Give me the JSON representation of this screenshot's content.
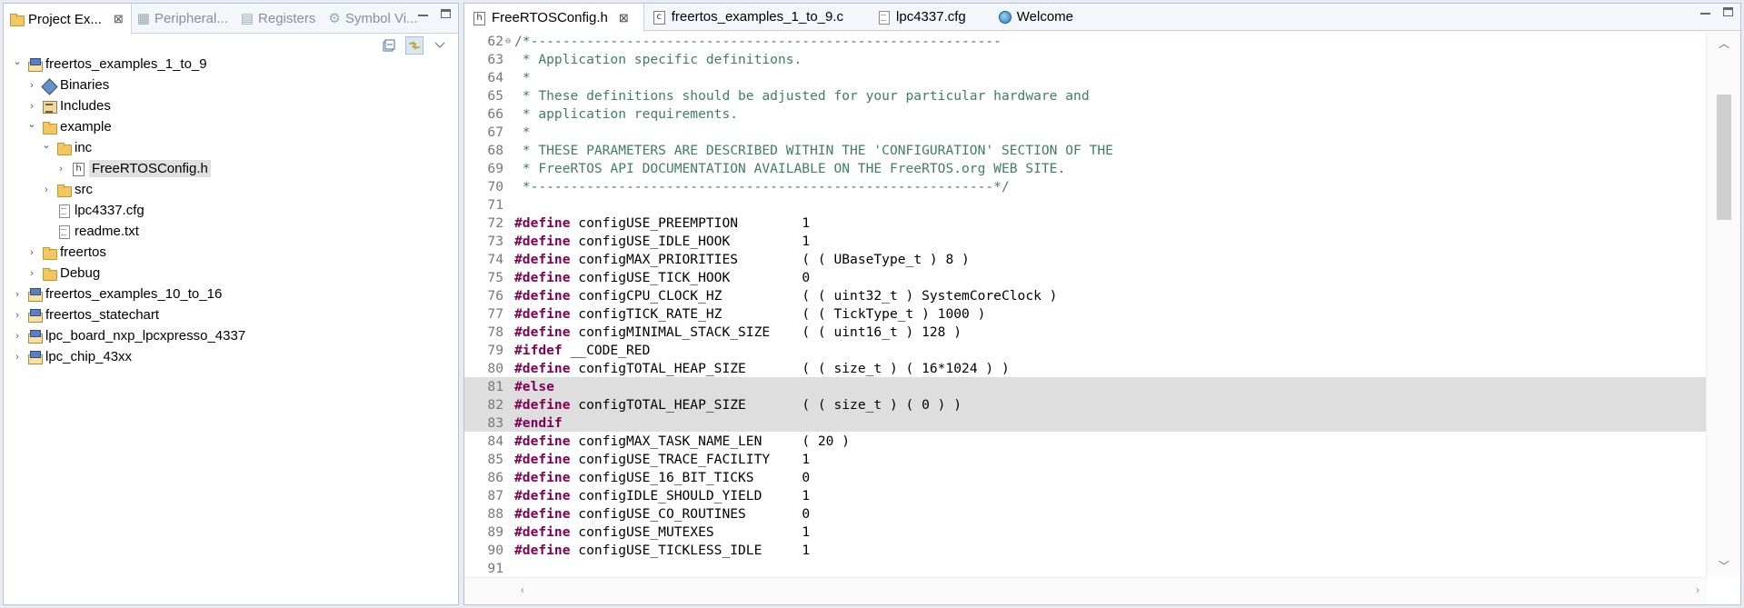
{
  "left_pane": {
    "tabs": [
      {
        "label": "Project Ex...",
        "close": "⊠",
        "active": true
      },
      {
        "label": "Peripheral...",
        "active": false
      },
      {
        "label": "Registers",
        "active": false
      },
      {
        "label": "Symbol Vi...",
        "active": false
      }
    ],
    "tree": [
      {
        "label": "freertos_examples_1_to_9",
        "expanded": true,
        "icon": "project-icon",
        "depth": 0
      },
      {
        "label": "Binaries",
        "expanded": false,
        "icon": "binaries-icon",
        "depth": 1
      },
      {
        "label": "Includes",
        "expanded": false,
        "icon": "includes-icon",
        "depth": 1
      },
      {
        "label": "example",
        "expanded": true,
        "icon": "folder-icon",
        "depth": 1
      },
      {
        "label": "inc",
        "expanded": true,
        "icon": "folder-icon",
        "depth": 2
      },
      {
        "label": "FreeRTOSConfig.h",
        "expanded": false,
        "icon": "header-file-icon",
        "depth": 3,
        "selected": true
      },
      {
        "label": "src",
        "expanded": false,
        "icon": "folder-icon",
        "depth": 2
      },
      {
        "label": "lpc4337.cfg",
        "icon": "file-icon",
        "depth": 2,
        "leaf": true
      },
      {
        "label": "readme.txt",
        "icon": "file-icon",
        "depth": 2,
        "leaf": true
      },
      {
        "label": "freertos",
        "expanded": false,
        "icon": "folder-icon",
        "depth": 1
      },
      {
        "label": "Debug",
        "expanded": false,
        "icon": "folder-icon",
        "depth": 1
      },
      {
        "label": "freertos_examples_10_to_16",
        "expanded": false,
        "icon": "project-icon",
        "depth": 0
      },
      {
        "label": "freertos_statechart",
        "expanded": false,
        "icon": "project-icon",
        "depth": 0
      },
      {
        "label": "lpc_board_nxp_lpcxpresso_4337",
        "expanded": false,
        "icon": "project-icon",
        "depth": 0
      },
      {
        "label": "lpc_chip_43xx",
        "expanded": false,
        "icon": "project-icon",
        "depth": 0
      }
    ]
  },
  "editor": {
    "tabs": [
      {
        "label": "FreeRTOSConfig.h",
        "icon": "header-file-icon",
        "active": true,
        "close": "⊠"
      },
      {
        "label": "freertos_examples_1_to_9.c",
        "icon": "c-file-icon",
        "active": false
      },
      {
        "label": "lpc4337.cfg",
        "icon": "file-icon",
        "active": false
      },
      {
        "label": "Welcome",
        "icon": "globe-icon",
        "active": false
      }
    ],
    "lines": [
      {
        "n": "62",
        "fold": "⊖",
        "parts": [
          [
            "c",
            "/*-----------------------------------------------------------"
          ]
        ]
      },
      {
        "n": "63",
        "parts": [
          [
            "c",
            " * Application specific definitions."
          ]
        ]
      },
      {
        "n": "64",
        "parts": [
          [
            "c",
            " *"
          ]
        ]
      },
      {
        "n": "65",
        "parts": [
          [
            "c",
            " * These definitions should be adjusted for your particular hardware and"
          ]
        ]
      },
      {
        "n": "66",
        "parts": [
          [
            "c",
            " * application requirements."
          ]
        ]
      },
      {
        "n": "67",
        "parts": [
          [
            "c",
            " *"
          ]
        ]
      },
      {
        "n": "68",
        "parts": [
          [
            "c",
            " * THESE PARAMETERS ARE DESCRIBED WITHIN THE 'CONFIGURATION' SECTION OF THE"
          ]
        ]
      },
      {
        "n": "69",
        "parts": [
          [
            "c",
            " * FreeRTOS API DOCUMENTATION AVAILABLE ON THE FreeRTOS.org WEB SITE."
          ]
        ]
      },
      {
        "n": "70",
        "parts": [
          [
            "c",
            " *----------------------------------------------------------*/"
          ]
        ]
      },
      {
        "n": "71",
        "parts": []
      },
      {
        "n": "72",
        "parts": [
          [
            "k",
            "#define"
          ],
          [
            "t",
            " configUSE_PREEMPTION        1"
          ]
        ]
      },
      {
        "n": "73",
        "parts": [
          [
            "k",
            "#define"
          ],
          [
            "t",
            " configUSE_IDLE_HOOK         1"
          ]
        ]
      },
      {
        "n": "74",
        "parts": [
          [
            "k",
            "#define"
          ],
          [
            "t",
            " configMAX_PRIORITIES        ( ( UBaseType_t ) 8 )"
          ]
        ]
      },
      {
        "n": "75",
        "parts": [
          [
            "k",
            "#define"
          ],
          [
            "t",
            " configUSE_TICK_HOOK         0"
          ]
        ]
      },
      {
        "n": "76",
        "parts": [
          [
            "k",
            "#define"
          ],
          [
            "t",
            " configCPU_CLOCK_HZ          ( ( uint32_t ) SystemCoreClock )"
          ]
        ]
      },
      {
        "n": "77",
        "parts": [
          [
            "k",
            "#define"
          ],
          [
            "t",
            " configTICK_RATE_HZ          ( ( TickType_t ) 1000 )"
          ]
        ]
      },
      {
        "n": "78",
        "parts": [
          [
            "k",
            "#define"
          ],
          [
            "t",
            " configMINIMAL_STACK_SIZE    ( ( uint16_t ) 128 )"
          ]
        ]
      },
      {
        "n": "79",
        "parts": [
          [
            "k",
            "#ifdef"
          ],
          [
            "t",
            " __CODE_RED"
          ]
        ]
      },
      {
        "n": "80",
        "parts": [
          [
            "k",
            "#define"
          ],
          [
            "t",
            " configTOTAL_HEAP_SIZE       ( ( size_t ) ( 16*1024 ) )"
          ]
        ]
      },
      {
        "n": "81",
        "hl": true,
        "parts": [
          [
            "k",
            "#else"
          ]
        ]
      },
      {
        "n": "82",
        "hl": true,
        "parts": [
          [
            "k",
            "#define"
          ],
          [
            "t",
            " configTOTAL_HEAP_SIZE       ( ( size_t ) ( 0 ) )"
          ]
        ]
      },
      {
        "n": "83",
        "hl": true,
        "parts": [
          [
            "k",
            "#endif"
          ]
        ]
      },
      {
        "n": "84",
        "parts": [
          [
            "k",
            "#define"
          ],
          [
            "t",
            " configMAX_TASK_NAME_LEN     ( 20 )"
          ]
        ]
      },
      {
        "n": "85",
        "parts": [
          [
            "k",
            "#define"
          ],
          [
            "t",
            " configUSE_TRACE_FACILITY    1"
          ]
        ]
      },
      {
        "n": "86",
        "parts": [
          [
            "k",
            "#define"
          ],
          [
            "t",
            " configUSE_16_BIT_TICKS      0"
          ]
        ]
      },
      {
        "n": "87",
        "parts": [
          [
            "k",
            "#define"
          ],
          [
            "t",
            " configIDLE_SHOULD_YIELD     1"
          ]
        ]
      },
      {
        "n": "88",
        "parts": [
          [
            "k",
            "#define"
          ],
          [
            "t",
            " configUSE_CO_ROUTINES       0"
          ]
        ]
      },
      {
        "n": "89",
        "parts": [
          [
            "k",
            "#define"
          ],
          [
            "t",
            " configUSE_MUTEXES           1"
          ]
        ]
      },
      {
        "n": "90",
        "parts": [
          [
            "k",
            "#define"
          ],
          [
            "t",
            " configUSE_TICKLESS_IDLE     1"
          ]
        ]
      },
      {
        "n": "91",
        "parts": []
      }
    ]
  },
  "colors": {
    "keyword": "#7f0055",
    "comment": "#3f7f5f",
    "highlight": "#dedede",
    "selection": "#e0e0e0"
  }
}
